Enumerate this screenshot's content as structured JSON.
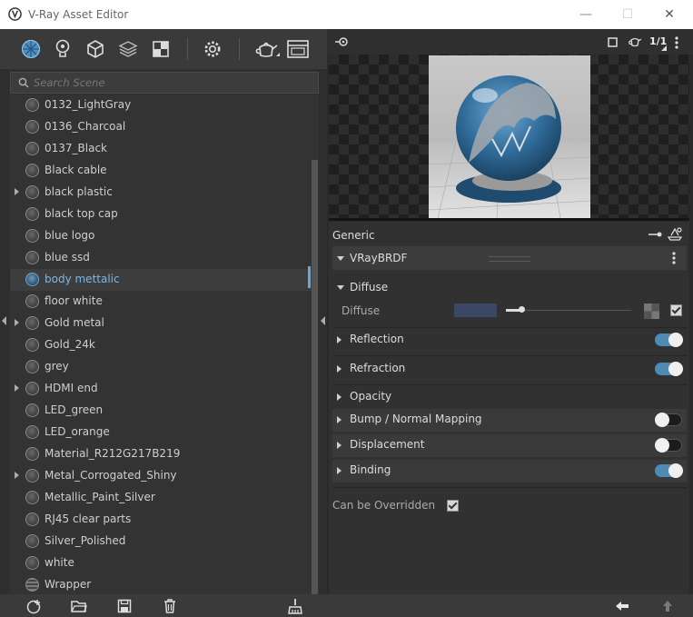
{
  "window": {
    "title": "V-Ray Asset Editor",
    "controls": {
      "minimize": "—",
      "maximize": "☐",
      "close": "✕"
    }
  },
  "toolbar": {
    "icons": [
      "materials-icon",
      "lights-icon",
      "geometry-icon",
      "render-elements-icon",
      "textures-icon",
      "settings-icon",
      "render-teapot-icon",
      "frame-buffer-icon"
    ],
    "active": "materials-icon"
  },
  "search": {
    "placeholder": "Search Scene"
  },
  "materials": [
    {
      "name": "0132_LightGray",
      "expandable": false
    },
    {
      "name": "0136_Charcoal",
      "expandable": false
    },
    {
      "name": "0137_Black",
      "expandable": false
    },
    {
      "name": "Black cable",
      "expandable": false
    },
    {
      "name": "black plastic",
      "expandable": true
    },
    {
      "name": "black top cap",
      "expandable": false
    },
    {
      "name": "blue logo",
      "expandable": false
    },
    {
      "name": "blue ssd",
      "expandable": false
    },
    {
      "name": "body mettalic",
      "expandable": false,
      "selected": true
    },
    {
      "name": "floor white",
      "expandable": false
    },
    {
      "name": "Gold metal",
      "expandable": true
    },
    {
      "name": "Gold_24k",
      "expandable": false
    },
    {
      "name": "grey",
      "expandable": false
    },
    {
      "name": "HDMI end",
      "expandable": true
    },
    {
      "name": "LED_green",
      "expandable": false
    },
    {
      "name": "LED_orange",
      "expandable": false
    },
    {
      "name": "Material_R212G217B219",
      "expandable": false
    },
    {
      "name": "Metal_Corrogated_Shiny",
      "expandable": true
    },
    {
      "name": "Metallic_Paint_Silver",
      "expandable": false
    },
    {
      "name": "RJ45 clear parts",
      "expandable": false
    },
    {
      "name": "Silver_Polished",
      "expandable": false
    },
    {
      "name": "white",
      "expandable": false
    },
    {
      "name": "Wrapper",
      "expandable": false,
      "wrapper": true
    }
  ],
  "preview": {
    "ratio_label": "1/1"
  },
  "properties": {
    "generic_label": "Generic",
    "brdf_label": "VRayBRDF",
    "diffuse_section": "Diffuse",
    "diffuse_param": "Diffuse",
    "diffuse_color": "#3b4764",
    "sections": [
      {
        "label": "Reflection",
        "toggle": true,
        "on": true
      },
      {
        "label": "Refraction",
        "toggle": true,
        "on": true
      },
      {
        "label": "Opacity",
        "toggle": false
      },
      {
        "label": "Bump / Normal Mapping",
        "toggle": true,
        "on": false
      },
      {
        "label": "Displacement",
        "toggle": true,
        "on": false
      },
      {
        "label": "Binding",
        "toggle": true,
        "on": true
      }
    ],
    "overridden_label": "Can be Overridden",
    "overridden_checked": true
  },
  "colors": {
    "accent": "#6aa6d6",
    "toggle_on": "#4e8ab5"
  }
}
